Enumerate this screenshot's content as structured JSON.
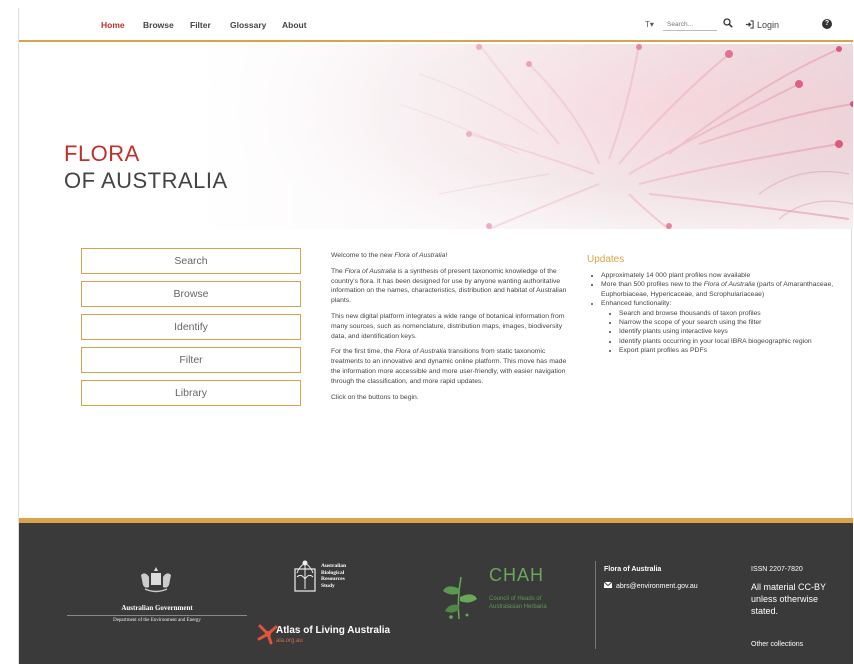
{
  "nav": {
    "items": [
      {
        "label": "Home",
        "active": true
      },
      {
        "label": "Browse",
        "active": false
      },
      {
        "label": "Filter",
        "active": false
      },
      {
        "label": "Glossary",
        "active": false
      },
      {
        "label": "About",
        "active": false
      }
    ],
    "text_size_label": "T▾",
    "search_placeholder": "Search...",
    "login_label": "Login",
    "help_icon": "?",
    "accent_color": "#d9a34a",
    "active_color": "#b8322a"
  },
  "hero": {
    "title_line1": "FLORA",
    "title_line2": "OF AUSTRALIA"
  },
  "side_buttons": [
    "Search",
    "Browse",
    "Identify",
    "Filter",
    "Library"
  ],
  "intro": {
    "welcome_prefix": "Welcome to the new ",
    "welcome_italic": "Flora of Australia",
    "welcome_suffix": "!",
    "p1_prefix": "The ",
    "p1_italic": "Flora of Australia",
    "p1_rest": " is a synthesis of present taxonomic knowledge of the country's flora. It has been designed for use by anyone wanting authoritative information on the names, characteristics, distribution and habitat of Australian plants.",
    "p2": "This new digital platform integrates a wide range of botanical information from many sources, such as nomenclature, distribution maps, images, biodiversity data, and identification keys.",
    "p3_prefix": "For the first time, the ",
    "p3_italic": "Flora of Australia",
    "p3_rest": " transitions from static taxonomic treatments to an innovative and dynamic online platform. This move has made the information more accessible and more user-friendly, with easier navigation through the classification, and more rapid updates.",
    "p4": "Click on the buttons to begin."
  },
  "updates": {
    "title": "Updates",
    "item1": "Approximately 14 000 plant profiles now available",
    "item2_prefix": "More than 500 profiles new to the ",
    "item2_italic": "Flora of Australia",
    "item2_rest": " (parts of Amaranthaceae, Euphorbiaceae, Hypericaceae, and Scrophulariaceae)",
    "item3": "Enhanced functionality:",
    "sub_items": [
      "Search and browse thousands of taxon profiles",
      "Narrow the scope of your search using the filter",
      "Identify plants using interactive keys",
      "Identify plants occurring in your local IBRA biogeographic region",
      "Export plant profiles as PDFs"
    ]
  },
  "footer": {
    "gov_name": "Australian Government",
    "gov_dept": "Department of the Environment and Energy",
    "abrs_lines": [
      "Australian",
      "Biological",
      "Resources",
      "Study"
    ],
    "ala_name": "Atlas of Living Australia",
    "ala_url": "ala.org.au",
    "chah_title": "CHAH",
    "chah_sub_1": "Council of Heads of",
    "chah_sub_2": "Australasian Herbaria",
    "foa_label": "Flora of Australia",
    "email": "abrs@environment.gov.au",
    "issn": "ISSN 2207-7820",
    "license": "All material CC-BY unless otherwise stated.",
    "other_collections": "Other collections"
  }
}
